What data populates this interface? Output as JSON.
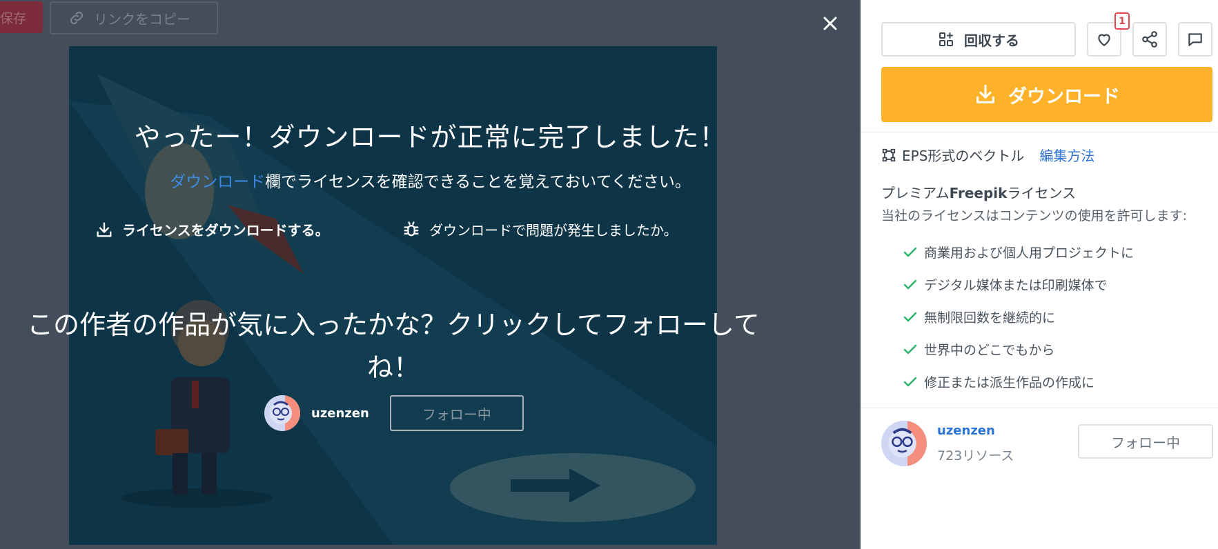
{
  "toolbar": {
    "save_label": "保存",
    "copy_link_label": "リンクをコピー"
  },
  "modal": {
    "title": "やったー！ダウンロードが正常に完了しました！",
    "subtitle_link": "ダウンロード",
    "subtitle_rest": "欄でライセンスを確認できることを覚えておいてください。",
    "license_download_label": "ライセンスをダウンロードする。",
    "problem_label": "ダウンロードで問題が発生しましたか。",
    "follow_prompt": "この作者の作品が気に入ったかな？クリックしてフォローしてね！",
    "author_name": "uzenzen",
    "follow_button": "フォロー中"
  },
  "panel": {
    "collect_label": "回収する",
    "like_count": "1",
    "download_label": "ダウンロード",
    "format_label": "EPS形式のベクトル",
    "edit_link": "編集方法",
    "license_title_prefix": "プレミアム",
    "license_title_brand": "Freepik",
    "license_title_suffix": "ライセンス",
    "license_subtitle": "当社のライセンスはコンテンツの使用を許可します:",
    "features": [
      "商業用および個人用プロジェクトに",
      "デジタル媒体または印刷媒体で",
      "無制限回数を継続的に",
      "世界中のどこでもから",
      "修正または派生作品の作成に"
    ],
    "author_name": "uzenzen",
    "resources": "723リソース",
    "follow_button": "フォロー中"
  },
  "colors": {
    "accent_download": "#fdb22a",
    "link_blue": "#2b74d3",
    "check_green": "#2fb46e",
    "badge_red": "#e0484c",
    "overlay": "#434e5a",
    "preview_bg": "#0e3547"
  },
  "icons": {
    "copy_link": "link-icon",
    "close": "close-icon",
    "license_download": "download-icon",
    "problem": "bug-icon",
    "collect": "collection-icon",
    "like": "heart-icon",
    "share": "share-icon",
    "comment": "comment-icon",
    "format": "vector-icon",
    "feature": "check-icon"
  }
}
